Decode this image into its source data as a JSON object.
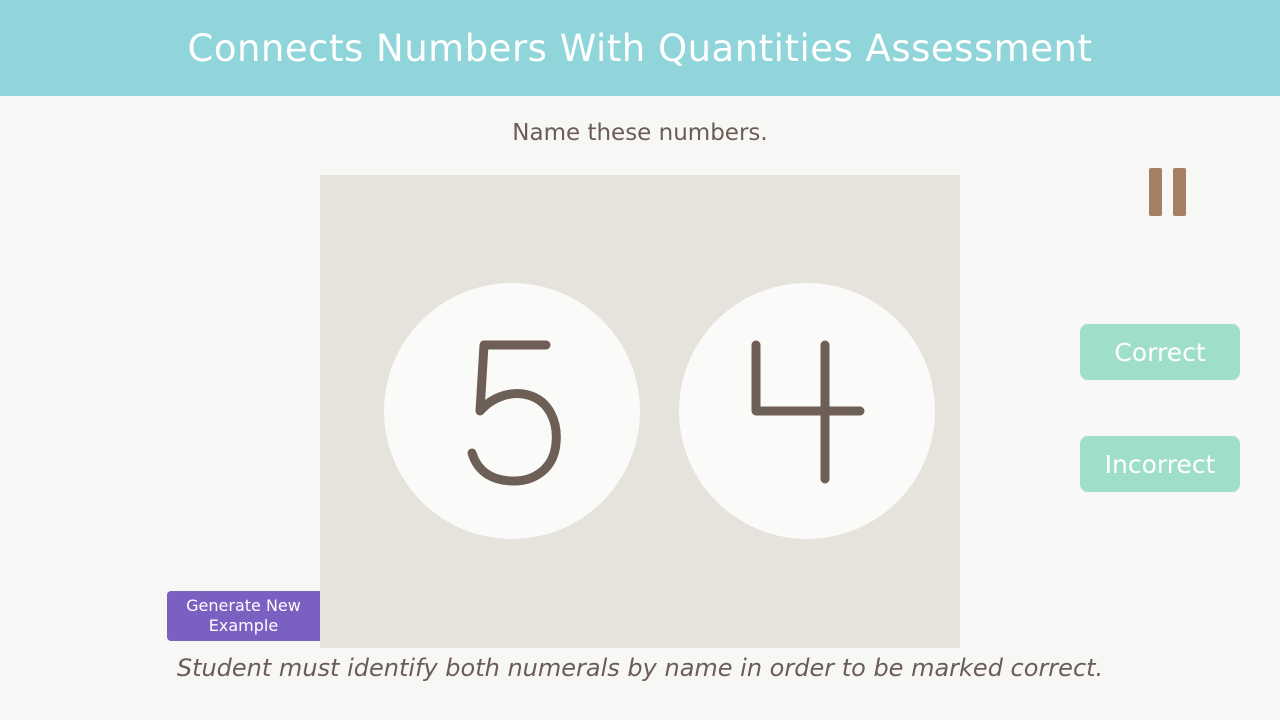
{
  "header": {
    "title": "Connects Numbers With Quantities Assessment"
  },
  "prompt": {
    "text": "Name these numbers."
  },
  "stage": {
    "numbers": [
      "5",
      "4"
    ],
    "digit_color": "#6e5f56"
  },
  "controls": {
    "pause_icon": "pause-icon",
    "correct_label": "Correct",
    "incorrect_label": "Incorrect",
    "generate_label": "Generate New\nExample"
  },
  "note": {
    "text": "Student must identify both numerals by name in order to be marked correct."
  },
  "colors": {
    "header_bg": "#8fd5d9",
    "answer_button": "#9fdfc9",
    "generate_button": "#7b5fc1",
    "pause": "#a47f63"
  }
}
